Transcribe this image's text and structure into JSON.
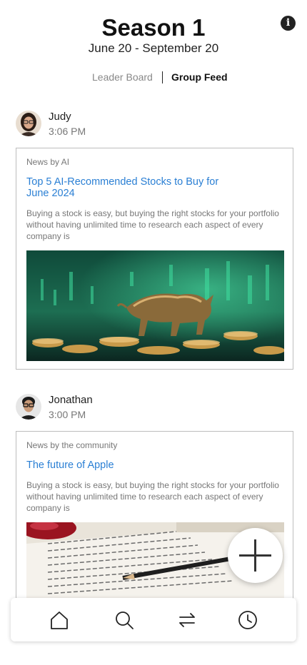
{
  "header": {
    "title": "Season 1",
    "dates": "June 20 - September 20",
    "info_icon": "info-icon"
  },
  "tabs": [
    {
      "label": "Leader Board",
      "active": false
    },
    {
      "label": "Group Feed",
      "active": true
    }
  ],
  "posts": [
    {
      "author": "Judy",
      "time": "3:06 PM",
      "source": "News by AI",
      "headline": "Top 5 AI-Recommended Stocks to Buy for June 2024",
      "description": "Buying a stock is easy, but buying the right stocks for your portfolio without having unlimited time to research each aspect of every company is",
      "image": "golden-bull-on-coins-image"
    },
    {
      "author": "Jonathan",
      "time": "3:00 PM",
      "source": "News by the community",
      "headline": "The future of Apple",
      "description": "Buying a stock is easy, but buying the right stocks for your portfolio without having unlimited time to research each aspect of every company is",
      "image": "documents-and-pencil-image"
    }
  ],
  "fab": {
    "icon": "plus-icon"
  },
  "bottom_nav": [
    {
      "icon": "home-icon"
    },
    {
      "icon": "search-icon"
    },
    {
      "icon": "transfer-arrows-icon"
    },
    {
      "icon": "clock-icon"
    }
  ],
  "colors": {
    "link": "#2a7fd4",
    "muted": "#777777",
    "text": "#222222"
  }
}
